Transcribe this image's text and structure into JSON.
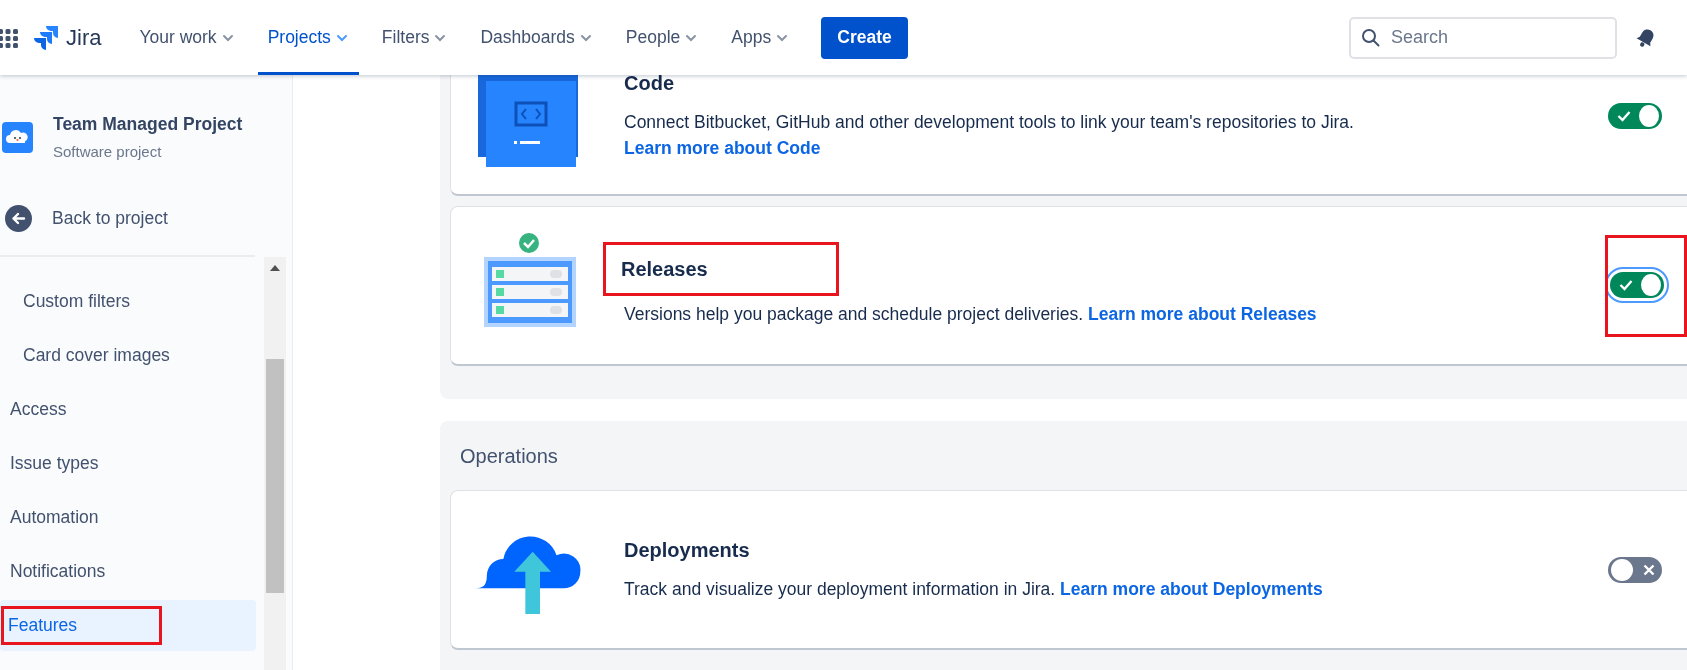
{
  "nav": {
    "logo": "Jira",
    "items": [
      {
        "label": "Your work",
        "selected": false
      },
      {
        "label": "Projects",
        "selected": true
      },
      {
        "label": "Filters",
        "selected": false
      },
      {
        "label": "Dashboards",
        "selected": false
      },
      {
        "label": "People",
        "selected": false
      },
      {
        "label": "Apps",
        "selected": false
      }
    ],
    "create": "Create",
    "search": {
      "placeholder": "Search"
    }
  },
  "sidebar": {
    "project": {
      "name": "Team Managed Project",
      "type": "Software project"
    },
    "back": "Back to project",
    "items": [
      {
        "label": "Custom filters",
        "kind": "sub",
        "selected": false,
        "highlighted": false
      },
      {
        "label": "Card cover images",
        "kind": "sub",
        "selected": false,
        "highlighted": false
      },
      {
        "label": "Access",
        "kind": "top",
        "selected": false,
        "highlighted": false
      },
      {
        "label": "Issue types",
        "kind": "top",
        "selected": false,
        "highlighted": false
      },
      {
        "label": "Automation",
        "kind": "top",
        "selected": false,
        "highlighted": false
      },
      {
        "label": "Notifications",
        "kind": "top",
        "selected": false,
        "highlighted": false
      },
      {
        "label": "Features",
        "kind": "top",
        "selected": true,
        "highlighted": true
      }
    ]
  },
  "sections": [
    {
      "features": [
        {
          "kind": "code",
          "title": "Code",
          "description": "Connect Bitbucket, GitHub and other development tools to link your team's repositories to Jira.",
          "link": "Learn more about Code",
          "on": true,
          "focused": false,
          "title_highlighted": false,
          "toggle_highlighted": false
        },
        {
          "kind": "releases",
          "title": "Releases",
          "description": "Versions help you package and schedule project deliveries.",
          "link": "Learn more about Releases",
          "on": true,
          "focused": true,
          "title_highlighted": true,
          "toggle_highlighted": true
        }
      ]
    },
    {
      "heading": "Operations",
      "features": [
        {
          "kind": "deployments",
          "title": "Deployments",
          "description": "Track and visualize your deployment information in Jira.",
          "link": "Learn more about Deployments",
          "on": false,
          "focused": false,
          "title_highlighted": false,
          "toggle_highlighted": false
        }
      ]
    }
  ]
}
